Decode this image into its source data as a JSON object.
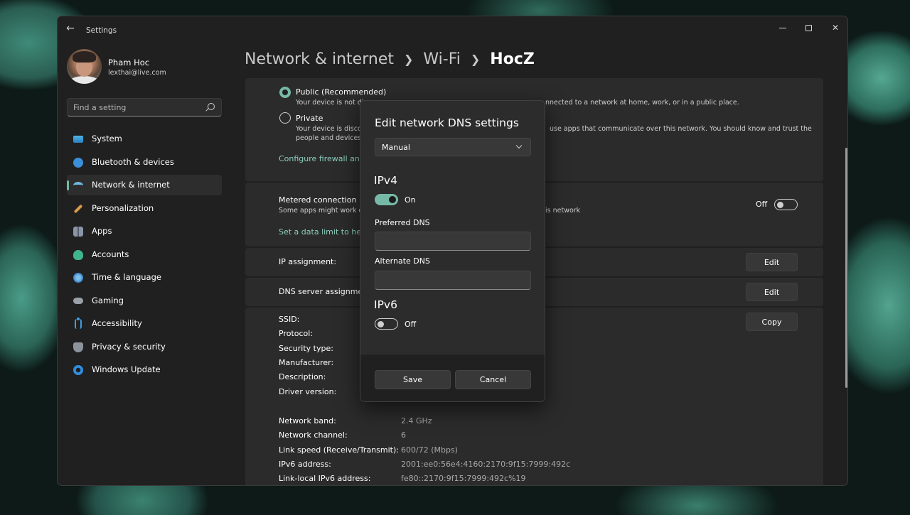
{
  "window": {
    "title": "Settings"
  },
  "profile": {
    "name": "Pham Hoc",
    "email": "lexthai@live.com"
  },
  "search": {
    "placeholder": "Find a setting"
  },
  "nav": {
    "items": [
      {
        "label": "System",
        "icon": "monitor-icon"
      },
      {
        "label": "Bluetooth & devices",
        "icon": "bluetooth-icon"
      },
      {
        "label": "Network & internet",
        "icon": "wifi-icon",
        "active": true
      },
      {
        "label": "Personalization",
        "icon": "brush-icon"
      },
      {
        "label": "Apps",
        "icon": "apps-icon"
      },
      {
        "label": "Accounts",
        "icon": "person-icon"
      },
      {
        "label": "Time & language",
        "icon": "globe-clock-icon"
      },
      {
        "label": "Gaming",
        "icon": "gamepad-icon"
      },
      {
        "label": "Accessibility",
        "icon": "accessibility-icon"
      },
      {
        "label": "Privacy & security",
        "icon": "shield-icon"
      },
      {
        "label": "Windows Update",
        "icon": "update-icon"
      }
    ]
  },
  "breadcrumb": {
    "level1": "Network & internet",
    "level2": "Wi-Fi",
    "current": "HocZ"
  },
  "profile_type": {
    "public_label": "Public (Recommended)",
    "public_desc_left": "Your device is not disc",
    "public_desc_right": "nnected to a network at home, work, or in a public place.",
    "private_label": "Private",
    "private_desc_left": "Your device is discov",
    "private_desc_right": "use apps that communicate over this network. You should know and trust the",
    "private_desc_line2": "people and devices o",
    "firewall_link": "Configure firewall and s"
  },
  "metered": {
    "title": "Metered connection",
    "desc_left": "Some apps might work dif",
    "desc_right": "is network",
    "state": "Off",
    "data_limit_link": "Set a data limit to help"
  },
  "ip_assignment": {
    "label": "IP assignment:",
    "button": "Edit"
  },
  "dns_assignment": {
    "label": "DNS server assignment",
    "button": "Edit"
  },
  "properties": {
    "copy_button": "Copy",
    "rows": [
      {
        "label": "SSID:",
        "value": ""
      },
      {
        "label": "Protocol:",
        "value": ""
      },
      {
        "label": "Security type:",
        "value": ""
      },
      {
        "label": "Manufacturer:",
        "value": ""
      },
      {
        "label": "Description:",
        "value": ""
      },
      {
        "label": "Driver version:",
        "value": ""
      },
      {
        "label": "",
        "value": ""
      },
      {
        "label": "Network band:",
        "value": "2.4 GHz"
      },
      {
        "label": "Network channel:",
        "value": "6"
      },
      {
        "label": "Link speed (Receive/Transmit):",
        "value": "600/72 (Mbps)"
      },
      {
        "label": "IPv6 address:",
        "value": "2001:ee0:56e4:4160:2170:9f15:7999:492c"
      },
      {
        "label": "Link-local IPv6 address:",
        "value": "fe80::2170:9f15:7999:492c%19"
      }
    ]
  },
  "dialog": {
    "title": "Edit network DNS settings",
    "mode": "Manual",
    "ipv4": {
      "heading": "IPv4",
      "state": "On",
      "preferred_label": "Preferred DNS",
      "preferred_value": "",
      "alternate_label": "Alternate DNS",
      "alternate_value": ""
    },
    "ipv6": {
      "heading": "IPv6",
      "state": "Off"
    },
    "save": "Save",
    "cancel": "Cancel"
  },
  "colors": {
    "accent": "#76b9a6",
    "window_bg": "#202020",
    "card_bg": "#2b2b2b",
    "link": "#8ccfbd"
  }
}
